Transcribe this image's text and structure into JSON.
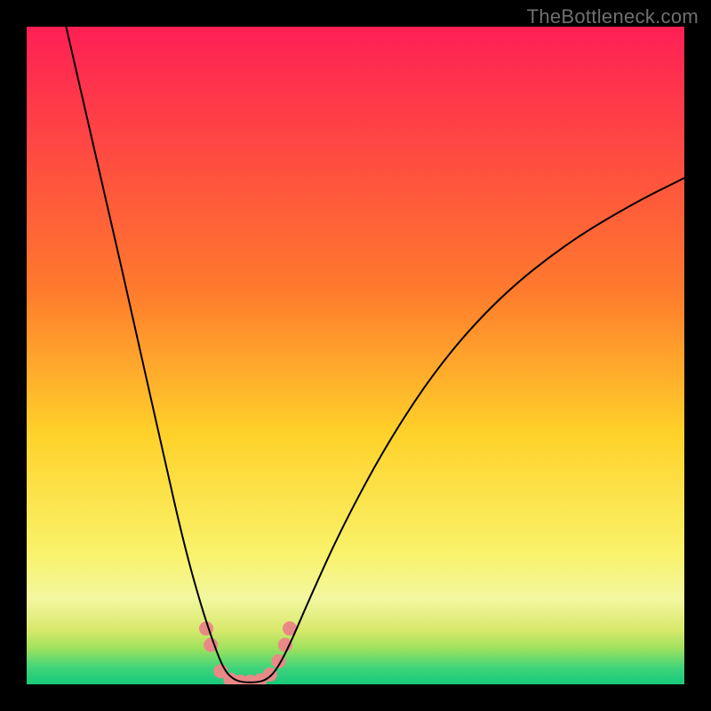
{
  "watermark": "TheBottleneck.com",
  "chart_data": {
    "type": "line",
    "title": "",
    "xlabel": "",
    "ylabel": "",
    "xlim": [
      0,
      100
    ],
    "ylim": [
      0,
      100
    ],
    "background": {
      "type": "vertical-gradient",
      "stops": [
        {
          "pos": 0.0,
          "color": "#ff1f55"
        },
        {
          "pos": 0.4,
          "color": "#ff7a2d"
        },
        {
          "pos": 0.62,
          "color": "#ffd22a"
        },
        {
          "pos": 0.8,
          "color": "#f9f26a"
        },
        {
          "pos": 0.87,
          "color": "#f3f7a0"
        },
        {
          "pos": 0.918,
          "color": "#d7e86a"
        },
        {
          "pos": 0.945,
          "color": "#9fe25e"
        },
        {
          "pos": 0.975,
          "color": "#3fd47a"
        },
        {
          "pos": 1.0,
          "color": "#17c97a"
        }
      ]
    },
    "series": [
      {
        "name": "curve",
        "stroke": "#000000",
        "stroke_width": 2,
        "points": [
          {
            "x": 6,
            "y": 100
          },
          {
            "x": 12,
            "y": 74
          },
          {
            "x": 17,
            "y": 52
          },
          {
            "x": 21,
            "y": 34
          },
          {
            "x": 24,
            "y": 21
          },
          {
            "x": 26.5,
            "y": 12
          },
          {
            "x": 28.5,
            "y": 6
          },
          {
            "x": 30,
            "y": 2.2
          },
          {
            "x": 31.5,
            "y": 0.7
          },
          {
            "x": 33,
            "y": 0.3
          },
          {
            "x": 35,
            "y": 0.3
          },
          {
            "x": 36.5,
            "y": 0.7
          },
          {
            "x": 38,
            "y": 2.2
          },
          {
            "x": 40,
            "y": 6
          },
          {
            "x": 43,
            "y": 13
          },
          {
            "x": 48,
            "y": 24
          },
          {
            "x": 55,
            "y": 37
          },
          {
            "x": 63,
            "y": 49
          },
          {
            "x": 72,
            "y": 59
          },
          {
            "x": 82,
            "y": 67
          },
          {
            "x": 92,
            "y": 73
          },
          {
            "x": 100,
            "y": 77
          }
        ]
      }
    ],
    "markers": {
      "color": "#e98987",
      "radius": 8,
      "points": [
        {
          "x": 27.3,
          "y": 8.5
        },
        {
          "x": 28.0,
          "y": 6.0
        },
        {
          "x": 29.5,
          "y": 2.0
        },
        {
          "x": 31.0,
          "y": 0.7
        },
        {
          "x": 32.5,
          "y": 0.4
        },
        {
          "x": 34.0,
          "y": 0.4
        },
        {
          "x": 35.5,
          "y": 0.6
        },
        {
          "x": 37.0,
          "y": 1.5
        },
        {
          "x": 38.3,
          "y": 3.5
        },
        {
          "x": 39.3,
          "y": 6.0
        },
        {
          "x": 40.0,
          "y": 8.5
        }
      ]
    }
  }
}
